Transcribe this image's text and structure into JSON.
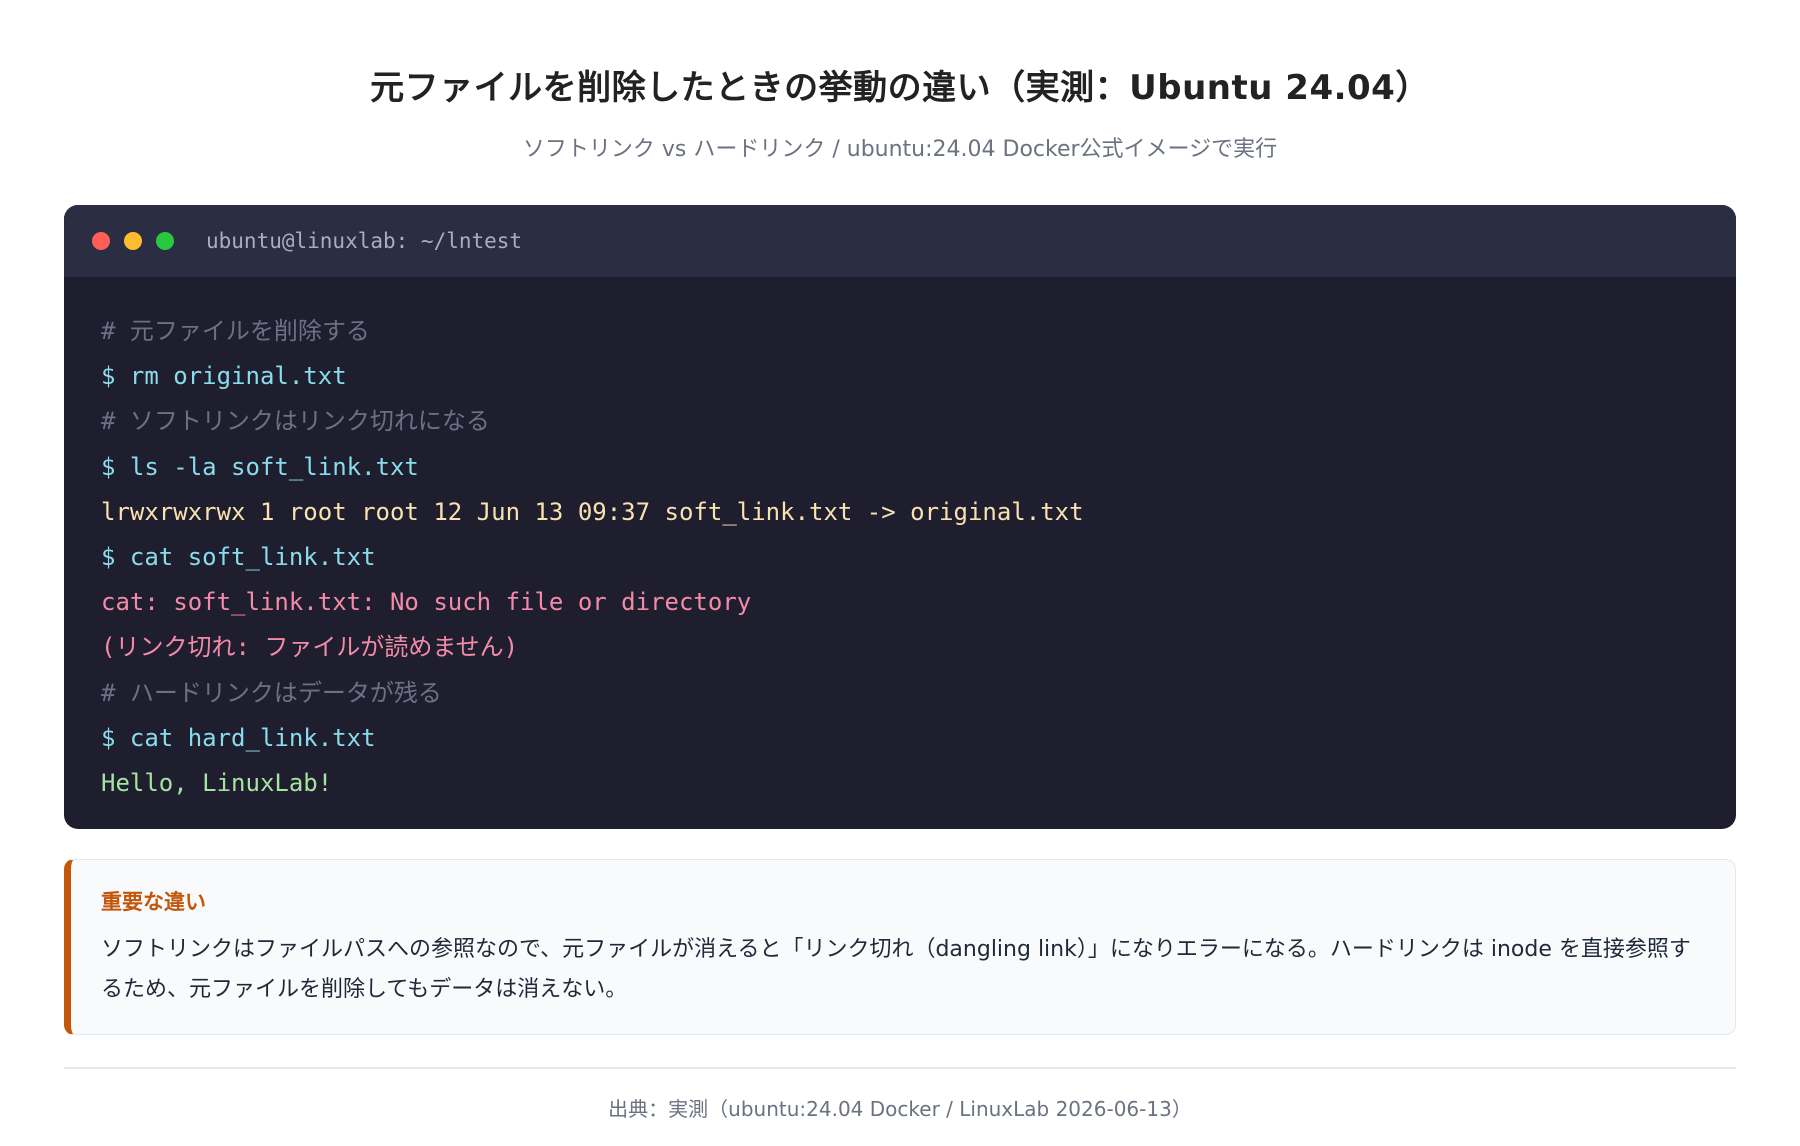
{
  "header": {
    "title": "元ファイルを削除したときの挙動の違い（実測：Ubuntu 24.04）",
    "subtitle": "ソフトリンク vs ハードリンク / ubuntu:24.04 Docker公式イメージで実行"
  },
  "terminal": {
    "window_title": "ubuntu@linuxlab: ~/lntest",
    "lines": [
      {
        "kind": "comment",
        "text": "# 元ファイルを削除する"
      },
      {
        "kind": "cmd",
        "text": "$ rm original.txt"
      },
      {
        "kind": "comment",
        "text": "# ソフトリンクはリンク切れになる"
      },
      {
        "kind": "cmd",
        "text": "$ ls -la soft_link.txt"
      },
      {
        "kind": "out",
        "text": "lrwxrwxrwx 1 root root 12 Jun 13 09:37 soft_link.txt -> original.txt"
      },
      {
        "kind": "cmd",
        "text": "$ cat soft_link.txt"
      },
      {
        "kind": "err",
        "text": "cat: soft_link.txt: No such file or directory"
      },
      {
        "kind": "err",
        "text": "(リンク切れ: ファイルが読めません)"
      },
      {
        "kind": "comment",
        "text": "# ハードリンクはデータが残る"
      },
      {
        "kind": "cmd",
        "text": "$ cat hard_link.txt"
      },
      {
        "kind": "ok",
        "text": "Hello, LinuxLab!"
      }
    ]
  },
  "note": {
    "heading": "重要な違い",
    "text": "ソフトリンクはファイルパスへの参照なので、元ファイルが消えると「リンク切れ（dangling link）」になりエラーになる。ハードリンクは inode を直接参照するため、元ファイルを削除してもデータは消えない。"
  },
  "footer": {
    "source": "出典：実測（ubuntu:24.04 Docker / LinuxLab 2026-06-13）"
  },
  "colors": {
    "accent": "#c2570c",
    "terminal_bg": "#1e1e2e"
  }
}
